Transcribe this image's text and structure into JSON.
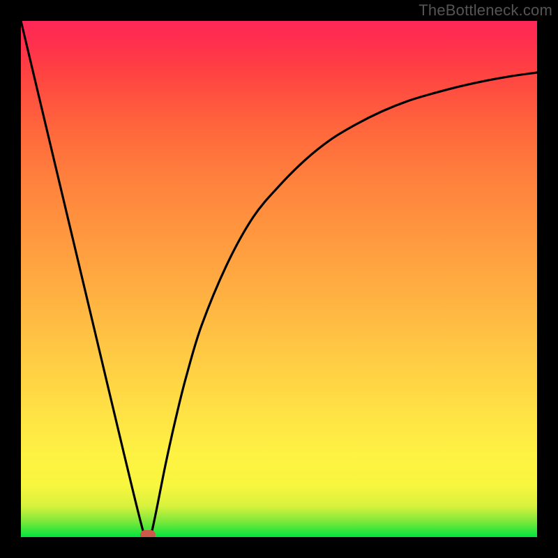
{
  "attribution": "TheBottleneck.com",
  "colors": {
    "frame": "#000000",
    "curve": "#000000",
    "marker": "#cc5a4a",
    "gradient_top": "#ff2757",
    "gradient_bottom": "#00e53c"
  },
  "chart_data": {
    "type": "line",
    "title": "",
    "xlabel": "",
    "ylabel": "",
    "xlim": [
      0,
      100
    ],
    "ylim": [
      0,
      100
    ],
    "grid": false,
    "legend": false,
    "series": [
      {
        "name": "bottleneck-curve",
        "x": [
          0,
          5,
          10,
          15,
          20,
          24,
          25,
          26,
          28,
          30,
          32,
          35,
          40,
          45,
          50,
          55,
          60,
          65,
          70,
          75,
          80,
          85,
          90,
          95,
          100
        ],
        "values": [
          100,
          79,
          58,
          37,
          16,
          0,
          0,
          4,
          14,
          23,
          31,
          41,
          53,
          62,
          68,
          73,
          77,
          80,
          82.5,
          84.5,
          86,
          87.3,
          88.4,
          89.3,
          90
        ]
      }
    ],
    "marker": {
      "x": 24.6,
      "y": 0,
      "shape": "rounded-rect"
    },
    "background_gradient": {
      "direction": "vertical",
      "stops": [
        {
          "pos": 0.0,
          "color": "#00e53c"
        },
        {
          "pos": 0.1,
          "color": "#f8f63e"
        },
        {
          "pos": 0.33,
          "color": "#ffcf44"
        },
        {
          "pos": 0.68,
          "color": "#ff843d"
        },
        {
          "pos": 1.0,
          "color": "#ff2757"
        }
      ]
    }
  }
}
